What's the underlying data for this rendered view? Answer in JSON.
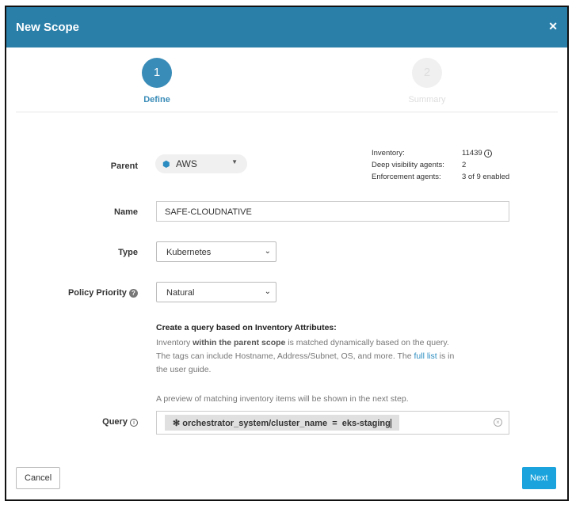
{
  "dialog": {
    "title": "New Scope",
    "close_icon": "close-icon"
  },
  "steps": [
    {
      "number": "1",
      "label": "Define",
      "state": "active"
    },
    {
      "number": "2",
      "label": "Summary",
      "state": "inactive"
    }
  ],
  "form": {
    "parent": {
      "label": "Parent",
      "value": "AWS",
      "icon": "cube-icon"
    },
    "inventory": {
      "inventory_label": "Inventory:",
      "inventory_value": "11439",
      "deep_label": "Deep visibility agents:",
      "deep_value": "2",
      "enforcement_label": "Enforcement agents:",
      "enforcement_value": "3 of 9 enabled"
    },
    "name": {
      "label": "Name",
      "value": "SAFE-CLOUDNATIVE"
    },
    "type": {
      "label": "Type",
      "value": "Kubernetes"
    },
    "policy_priority": {
      "label": "Policy Priority",
      "value": "Natural"
    },
    "query_help": {
      "heading": "Create a query based on Inventory Attributes:",
      "p1": "Inventory ",
      "p1_bold": "within the parent scope",
      "p1_rest": " is matched dynamically based on the query. The tags can include Hostname, Address/Subnet, OS, and more. The ",
      "link": "full list",
      "p1_end": " is in the user guide.",
      "preview": "A preview of matching inventory items will be shown in the next step."
    },
    "query": {
      "label": "Query",
      "chip_symbol": "✻",
      "chip": "orchestrator_system/cluster_name  =  eks-staging"
    }
  },
  "footer": {
    "cancel": "Cancel",
    "next": "Next"
  },
  "colors": {
    "header": "#2a7fa9",
    "accent": "#3a8cb8",
    "next_button": "#1aa3dc"
  }
}
